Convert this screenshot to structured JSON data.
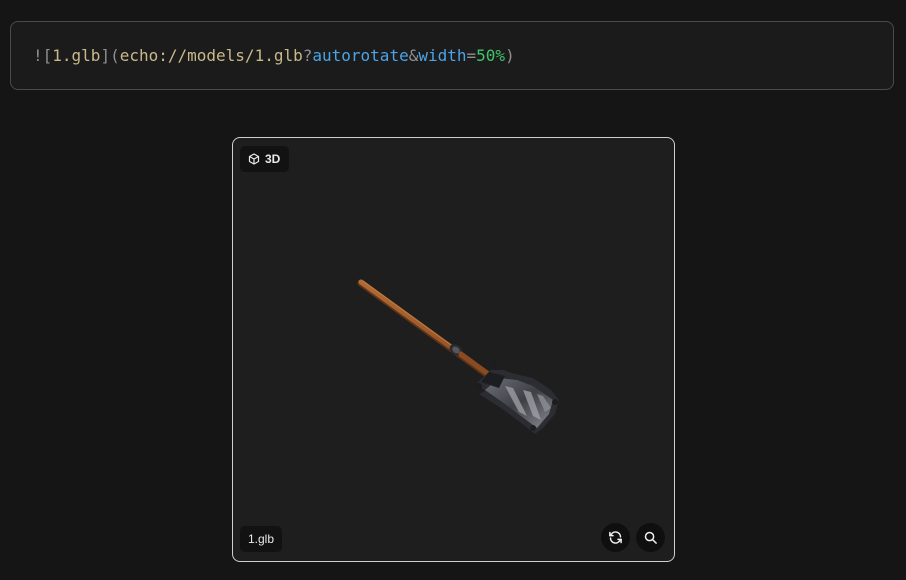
{
  "code": {
    "bang_bracket": "![",
    "alt": "1.glb",
    "close_open": "](",
    "url": "echo://models/1.glb",
    "q": "?",
    "param1": "autorotate",
    "amp": "&",
    "param2": "width",
    "eq": "=",
    "value2": "50%",
    "close": ")"
  },
  "viewer": {
    "badge_label": "3D",
    "filename": "1.glb",
    "icons": {
      "badge": "cube-icon",
      "rotate": "refresh-icon",
      "zoom": "magnifier-icon"
    }
  }
}
